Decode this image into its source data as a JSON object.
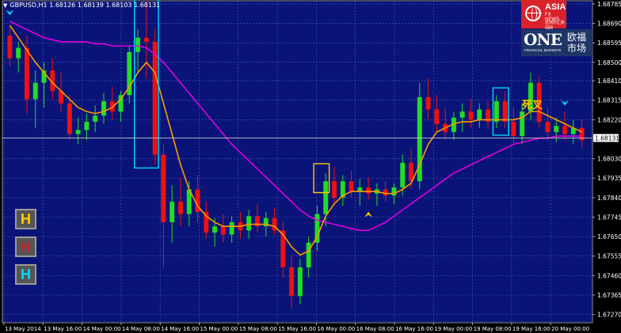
{
  "window": {
    "symbol_line": "GBPUSD,H1  1.68126 1.68139 1.68103 1.68131"
  },
  "annotation": {
    "death_cross_label": "死叉"
  },
  "buttons": [
    {
      "label": "H",
      "color": "#ffcc00"
    },
    {
      "label": "H",
      "color": "#cc2222"
    },
    {
      "label": "H",
      "color": "#00d8ff"
    }
  ],
  "logos": {
    "asia_fx": {
      "line1": "ASIA",
      "line2": "FX NEWS",
      "line3": "亚洲外汇新闻网"
    },
    "one": {
      "big": "ONE",
      "sub": "FINANCIAL MARKETS",
      "cn": "欧福 市场"
    }
  },
  "colors": {
    "background": "#000000",
    "plot_area": "#0a1478",
    "grid": "#4b5ab0",
    "bull_candle": "#22dd22",
    "bear_candle": "#ee1111",
    "fast_ma": "#ff9900",
    "slow_ma": "#e000e0",
    "box_cyan": "#00d8ff",
    "box_yellow": "#ffcc00",
    "current_price_line": "#c8c8c8"
  },
  "chart_data": {
    "type": "candlestick",
    "symbol": "GBPUSD",
    "timeframe": "H1",
    "ohlc_header": {
      "open": 1.68126,
      "high": 1.68139,
      "low": 1.68103,
      "close": 1.68131
    },
    "current_price_label": "1.68131",
    "y_ticks": [
      "1.68785",
      "1.68690",
      "1.68595",
      "1.68500",
      "1.68410",
      "1.68315",
      "1.68220",
      "1.68030",
      "1.67935",
      "1.67840",
      "1.67745",
      "1.67650",
      "1.67555",
      "1.67460",
      "1.67365",
      "1.67270"
    ],
    "x_ticks": [
      "13 May 2014",
      "13 May 16:00",
      "14 May 00:00",
      "14 May 08:00",
      "14 May 16:00",
      "15 May 00:00",
      "15 May 08:00",
      "15 May 16:00",
      "16 May 00:00",
      "16 May 08:00",
      "16 May 16:00",
      "19 May 00:00",
      "19 May 08:00",
      "19 May 16:00",
      "20 May 00:00"
    ],
    "ylim": [
      1.6723,
      1.688
    ],
    "current_price": 1.68131,
    "candles": [
      {
        "o": 1.6863,
        "h": 1.6868,
        "l": 1.6848,
        "c": 1.6852
      },
      {
        "o": 1.6852,
        "h": 1.686,
        "l": 1.6845,
        "c": 1.6857
      },
      {
        "o": 1.6857,
        "h": 1.6863,
        "l": 1.6825,
        "c": 1.6832
      },
      {
        "o": 1.6832,
        "h": 1.6846,
        "l": 1.6818,
        "c": 1.684
      },
      {
        "o": 1.684,
        "h": 1.685,
        "l": 1.6828,
        "c": 1.6846
      },
      {
        "o": 1.6846,
        "h": 1.6852,
        "l": 1.6832,
        "c": 1.6836
      },
      {
        "o": 1.6836,
        "h": 1.6845,
        "l": 1.6826,
        "c": 1.683
      },
      {
        "o": 1.683,
        "h": 1.6834,
        "l": 1.6812,
        "c": 1.6815
      },
      {
        "o": 1.6815,
        "h": 1.6823,
        "l": 1.681,
        "c": 1.6817
      },
      {
        "o": 1.6817,
        "h": 1.6825,
        "l": 1.6812,
        "c": 1.6821
      },
      {
        "o": 1.6821,
        "h": 1.6829,
        "l": 1.6816,
        "c": 1.6824
      },
      {
        "o": 1.6824,
        "h": 1.6835,
        "l": 1.682,
        "c": 1.6831
      },
      {
        "o": 1.6831,
        "h": 1.6838,
        "l": 1.6822,
        "c": 1.6826
      },
      {
        "o": 1.6826,
        "h": 1.6836,
        "l": 1.6821,
        "c": 1.6834
      },
      {
        "o": 1.6834,
        "h": 1.6858,
        "l": 1.683,
        "c": 1.6855
      },
      {
        "o": 1.6855,
        "h": 1.6866,
        "l": 1.6845,
        "c": 1.6862
      },
      {
        "o": 1.6862,
        "h": 1.688,
        "l": 1.6842,
        "c": 1.686
      },
      {
        "o": 1.686,
        "h": 1.6866,
        "l": 1.68,
        "c": 1.6805
      },
      {
        "o": 1.6805,
        "h": 1.681,
        "l": 1.675,
        "c": 1.6772
      },
      {
        "o": 1.6772,
        "h": 1.679,
        "l": 1.6762,
        "c": 1.6782
      },
      {
        "o": 1.6782,
        "h": 1.6794,
        "l": 1.677,
        "c": 1.6776
      },
      {
        "o": 1.6776,
        "h": 1.6792,
        "l": 1.677,
        "c": 1.6788
      },
      {
        "o": 1.6788,
        "h": 1.6795,
        "l": 1.6772,
        "c": 1.6777
      },
      {
        "o": 1.6777,
        "h": 1.6782,
        "l": 1.6764,
        "c": 1.6767
      },
      {
        "o": 1.6767,
        "h": 1.6774,
        "l": 1.676,
        "c": 1.677
      },
      {
        "o": 1.677,
        "h": 1.6776,
        "l": 1.6762,
        "c": 1.6766
      },
      {
        "o": 1.6766,
        "h": 1.6775,
        "l": 1.6762,
        "c": 1.6772
      },
      {
        "o": 1.6772,
        "h": 1.6777,
        "l": 1.6764,
        "c": 1.6768
      },
      {
        "o": 1.6768,
        "h": 1.6778,
        "l": 1.6764,
        "c": 1.6775
      },
      {
        "o": 1.6775,
        "h": 1.6781,
        "l": 1.6767,
        "c": 1.677
      },
      {
        "o": 1.677,
        "h": 1.6777,
        "l": 1.6765,
        "c": 1.6774
      },
      {
        "o": 1.6774,
        "h": 1.6779,
        "l": 1.6766,
        "c": 1.6768
      },
      {
        "o": 1.6768,
        "h": 1.6772,
        "l": 1.6745,
        "c": 1.675
      },
      {
        "o": 1.675,
        "h": 1.6756,
        "l": 1.673,
        "c": 1.6736
      },
      {
        "o": 1.6736,
        "h": 1.6754,
        "l": 1.6732,
        "c": 1.675
      },
      {
        "o": 1.675,
        "h": 1.6765,
        "l": 1.6745,
        "c": 1.6762
      },
      {
        "o": 1.6762,
        "h": 1.678,
        "l": 1.6758,
        "c": 1.6776
      },
      {
        "o": 1.6776,
        "h": 1.6796,
        "l": 1.677,
        "c": 1.6792
      },
      {
        "o": 1.6792,
        "h": 1.6799,
        "l": 1.678,
        "c": 1.6784
      },
      {
        "o": 1.6784,
        "h": 1.6795,
        "l": 1.678,
        "c": 1.6792
      },
      {
        "o": 1.6792,
        "h": 1.6797,
        "l": 1.6784,
        "c": 1.6787
      },
      {
        "o": 1.6787,
        "h": 1.6793,
        "l": 1.678,
        "c": 1.6789
      },
      {
        "o": 1.6789,
        "h": 1.6794,
        "l": 1.6783,
        "c": 1.6786
      },
      {
        "o": 1.6786,
        "h": 1.6791,
        "l": 1.678,
        "c": 1.6788
      },
      {
        "o": 1.6788,
        "h": 1.6792,
        "l": 1.6782,
        "c": 1.6785
      },
      {
        "o": 1.6785,
        "h": 1.6791,
        "l": 1.6781,
        "c": 1.6789
      },
      {
        "o": 1.6789,
        "h": 1.6805,
        "l": 1.6785,
        "c": 1.6801
      },
      {
        "o": 1.6801,
        "h": 1.6808,
        "l": 1.6788,
        "c": 1.6792
      },
      {
        "o": 1.6792,
        "h": 1.684,
        "l": 1.6788,
        "c": 1.6833
      },
      {
        "o": 1.6833,
        "h": 1.6842,
        "l": 1.6822,
        "c": 1.6827
      },
      {
        "o": 1.6827,
        "h": 1.6834,
        "l": 1.6816,
        "c": 1.682
      },
      {
        "o": 1.682,
        "h": 1.6828,
        "l": 1.6812,
        "c": 1.6816
      },
      {
        "o": 1.6816,
        "h": 1.6826,
        "l": 1.6812,
        "c": 1.6823
      },
      {
        "o": 1.6823,
        "h": 1.683,
        "l": 1.6816,
        "c": 1.6826
      },
      {
        "o": 1.6826,
        "h": 1.6832,
        "l": 1.6818,
        "c": 1.6822
      },
      {
        "o": 1.6822,
        "h": 1.683,
        "l": 1.6818,
        "c": 1.6827
      },
      {
        "o": 1.6827,
        "h": 1.6831,
        "l": 1.6818,
        "c": 1.6821
      },
      {
        "o": 1.6821,
        "h": 1.6834,
        "l": 1.6818,
        "c": 1.6831
      },
      {
        "o": 1.6831,
        "h": 1.6836,
        "l": 1.6818,
        "c": 1.6821
      },
      {
        "o": 1.6821,
        "h": 1.6828,
        "l": 1.681,
        "c": 1.6814
      },
      {
        "o": 1.6814,
        "h": 1.683,
        "l": 1.681,
        "c": 1.6826
      },
      {
        "o": 1.6826,
        "h": 1.6845,
        "l": 1.6822,
        "c": 1.684
      },
      {
        "o": 1.684,
        "h": 1.6843,
        "l": 1.6818,
        "c": 1.6821
      },
      {
        "o": 1.6821,
        "h": 1.6828,
        "l": 1.6812,
        "c": 1.6816
      },
      {
        "o": 1.6816,
        "h": 1.6823,
        "l": 1.6811,
        "c": 1.6819
      },
      {
        "o": 1.6819,
        "h": 1.6826,
        "l": 1.6812,
        "c": 1.6815
      },
      {
        "o": 1.6815,
        "h": 1.6822,
        "l": 1.681,
        "c": 1.6818
      },
      {
        "o": 1.6818,
        "h": 1.6822,
        "l": 1.6808,
        "c": 1.6812
      }
    ],
    "ma_fast": [
      1.6868,
      1.6862,
      1.6856,
      1.685,
      1.6845,
      1.684,
      1.6836,
      1.6832,
      1.6828,
      1.6826,
      1.6825,
      1.6826,
      1.6828,
      1.6832,
      1.6838,
      1.6845,
      1.685,
      1.6845,
      1.683,
      1.6815,
      1.68,
      1.6788,
      1.678,
      1.6775,
      1.6772,
      1.677,
      1.677,
      1.677,
      1.6771,
      1.6771,
      1.6771,
      1.677,
      1.6766,
      1.676,
      1.6756,
      1.6758,
      1.6765,
      1.6775,
      1.6781,
      1.6785,
      1.6787,
      1.6787,
      1.6787,
      1.6787,
      1.6786,
      1.6786,
      1.6788,
      1.6791,
      1.68,
      1.681,
      1.6816,
      1.6818,
      1.682,
      1.6821,
      1.6821,
      1.6822,
      1.6822,
      1.6822,
      1.6822,
      1.6822,
      1.6823,
      1.6826,
      1.6826,
      1.6824,
      1.6822,
      1.682,
      1.6818,
      1.6816
    ],
    "ma_slow": [
      1.687,
      1.6868,
      1.6866,
      1.6864,
      1.6862,
      1.6861,
      1.686,
      1.686,
      1.686,
      1.686,
      1.6859,
      1.6859,
      1.6858,
      1.6858,
      1.6858,
      1.6858,
      1.6857,
      1.6854,
      1.685,
      1.6845,
      1.684,
      1.6835,
      1.683,
      1.6825,
      1.682,
      1.6815,
      1.681,
      1.6806,
      1.6802,
      1.6798,
      1.6794,
      1.679,
      1.6786,
      1.6782,
      1.6778,
      1.6775,
      1.6773,
      1.6772,
      1.6771,
      1.677,
      1.6769,
      1.6768,
      1.6768,
      1.677,
      1.6772,
      1.6775,
      1.6778,
      1.6781,
      1.6784,
      1.6787,
      1.679,
      1.6793,
      1.6796,
      1.6798,
      1.68,
      1.6802,
      1.6804,
      1.6806,
      1.6808,
      1.681,
      1.6811,
      1.6812,
      1.6813,
      1.6813,
      1.6814,
      1.6814,
      1.6814,
      1.6814
    ],
    "highlight_boxes": [
      {
        "from": 15,
        "to": 17,
        "low": 1.68,
        "high": 1.688,
        "color": "cyan"
      },
      {
        "from": 36,
        "to": 37,
        "low": 1.6788,
        "high": 1.6799,
        "color": "yellow"
      },
      {
        "from": 57,
        "to": 58,
        "low": 1.6816,
        "high": 1.6836,
        "color": "cyan"
      }
    ],
    "arrows": [
      {
        "at": 0,
        "price": 1.6874,
        "dir": "down",
        "color": "cyan"
      },
      {
        "at": 42,
        "price": 1.6776,
        "dir": "up",
        "color": "yellow"
      },
      {
        "at": 65,
        "price": 1.683,
        "dir": "down",
        "color": "cyan"
      }
    ]
  }
}
